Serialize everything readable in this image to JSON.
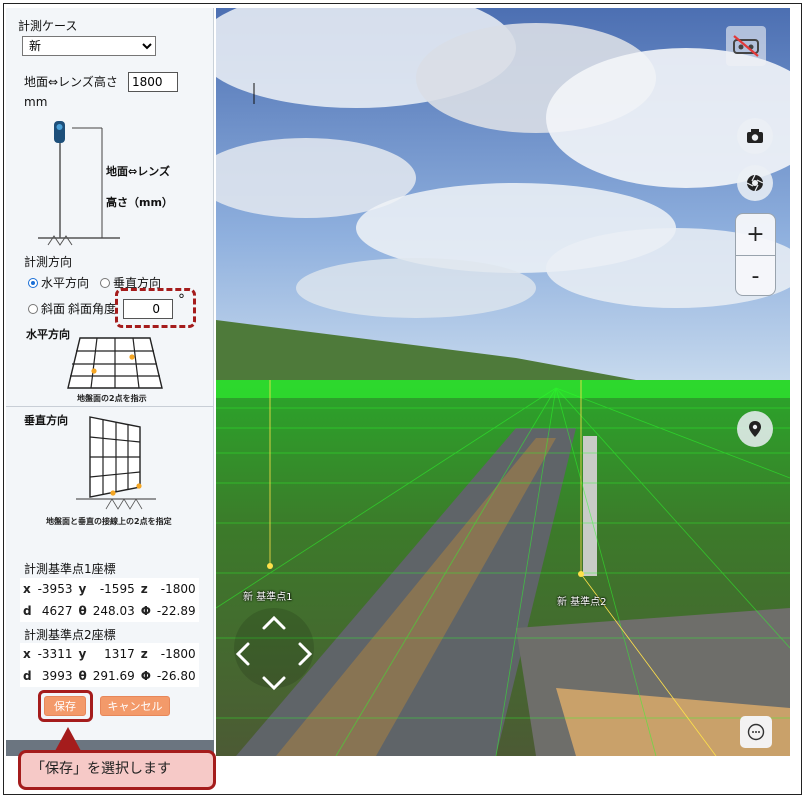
{
  "panel": {
    "case_label": "計測ケース",
    "case_value": "新",
    "height_label": "地面⇔レンズ高さ",
    "height_value": "1800",
    "height_unit": "mm",
    "diagram_label_line1": "地面⇔レンズ",
    "diagram_label_line2": "高さ（mm）",
    "direction_label": "計測方向",
    "radio_horizontal": "水平方向",
    "radio_vertical": "垂直方向",
    "radio_slope": "斜面",
    "slope_angle_label": "斜面角度",
    "slope_angle_value": "0",
    "degree_symbol": "°",
    "horizontal_heading": "水平方向",
    "horizontal_caption": "地盤面の2点を指示",
    "vertical_heading": "垂直方向",
    "vertical_caption": "地盤面と垂直の接線上の2点を指定",
    "point1_heading": "計測基準点1座標",
    "point1": {
      "x_label": "x",
      "x": "-3953",
      "y_label": "y",
      "y": "-1595",
      "z_label": "z",
      "z": "-1800",
      "d_label": "d",
      "d": "4627",
      "theta_label": "θ",
      "theta": "248.03",
      "phi_label": "Φ",
      "phi": "-22.89"
    },
    "point2_heading": "計測基準点2座標",
    "point2": {
      "x_label": "x",
      "x": "-3311",
      "y_label": "y",
      "y": "1317",
      "z_label": "z",
      "z": "-1800",
      "d_label": "d",
      "d": "3993",
      "theta_label": "θ",
      "theta": "291.69",
      "phi_label": "Φ",
      "phi": "-26.80"
    },
    "save_button": "保存",
    "cancel_button": "キャンセル"
  },
  "viewer": {
    "zoom_in": "+",
    "zoom_out": "-",
    "point1_label": "新 基準点1",
    "point2_label": "新 基準点2"
  },
  "callout": {
    "text": "「保存」を選択します"
  },
  "colors": {
    "accent_red": "#a51c1c",
    "button_orange": "#f39a6a",
    "grid_green": "#2bff2b"
  }
}
